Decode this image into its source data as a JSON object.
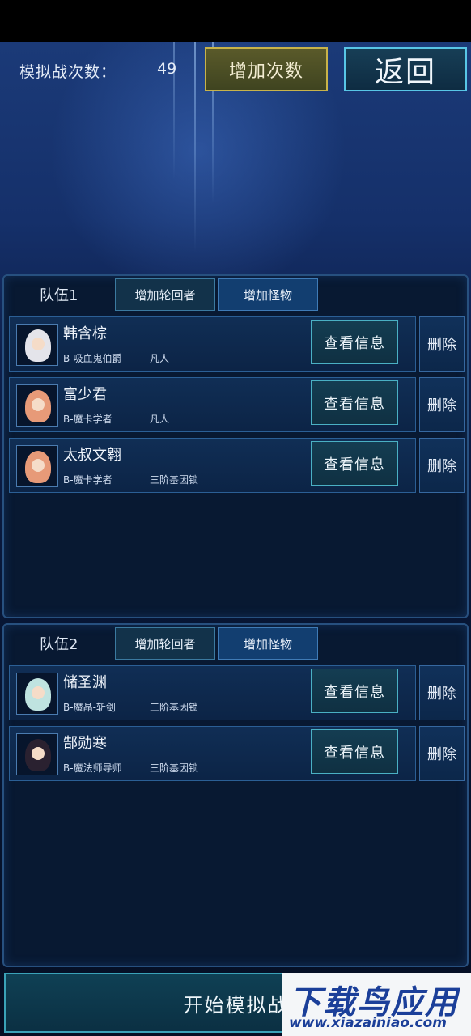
{
  "top": {
    "sim_label": "模拟战次数：",
    "sim_count": "49",
    "add_count_button": "增加次数",
    "back_button": "返回"
  },
  "teams": [
    {
      "title": "队伍1",
      "tab_add_hero": "增加轮回者",
      "tab_add_monster": "增加怪物",
      "members": [
        {
          "name": "韩含棕",
          "class": "B-吸血鬼伯爵",
          "rank": "凡人",
          "info": "查看信息",
          "delete": "删除"
        },
        {
          "name": "富少君",
          "class": "B-魔卡学者",
          "rank": "凡人",
          "info": "查看信息",
          "delete": "删除"
        },
        {
          "name": "太叔文翱",
          "class": "B-魔卡学者",
          "rank": "三阶基因锁",
          "info": "查看信息",
          "delete": "删除"
        }
      ]
    },
    {
      "title": "队伍2",
      "tab_add_hero": "增加轮回者",
      "tab_add_monster": "增加怪物",
      "members": [
        {
          "name": "储圣渊",
          "class": "B-魔晶-斩剑",
          "rank": "三阶基因锁",
          "info": "查看信息",
          "delete": "删除"
        },
        {
          "name": "郜勋寒",
          "class": "B-魔法师导师",
          "rank": "三阶基因锁",
          "info": "查看信息",
          "delete": "删除"
        }
      ]
    }
  ],
  "start_button": "开始模拟战",
  "watermark": {
    "title": "下载鸟应用",
    "url": "www.xiazainiao.com"
  },
  "colors": {
    "accent_gold": "#c8b34a",
    "accent_cyan": "#58c6e6",
    "panel_bg": "#081932"
  },
  "icons": [
    "character-avatar-icon"
  ]
}
